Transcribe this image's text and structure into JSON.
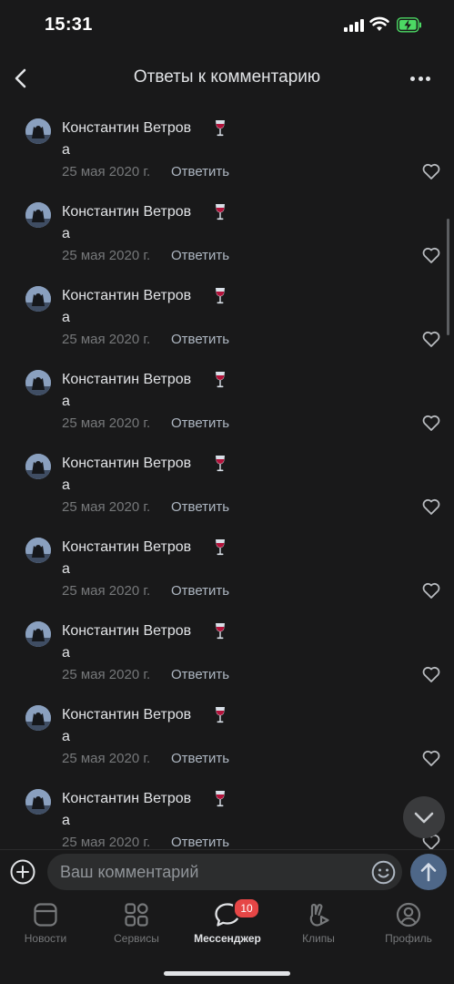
{
  "status_bar": {
    "time": "15:31"
  },
  "header": {
    "title": "Ответы к комментарию"
  },
  "comments": [
    {
      "author": "Константин Ветров",
      "text": "а",
      "date": "25 мая 2020 г.",
      "reply_label": "Ответить"
    },
    {
      "author": "Константин Ветров",
      "text": "а",
      "date": "25 мая 2020 г.",
      "reply_label": "Ответить"
    },
    {
      "author": "Константин Ветров",
      "text": "а",
      "date": "25 мая 2020 г.",
      "reply_label": "Ответить"
    },
    {
      "author": "Константин Ветров",
      "text": "а",
      "date": "25 мая 2020 г.",
      "reply_label": "Ответить"
    },
    {
      "author": "Константин Ветров",
      "text": "а",
      "date": "25 мая 2020 г.",
      "reply_label": "Ответить"
    },
    {
      "author": "Константин Ветров",
      "text": "а",
      "date": "25 мая 2020 г.",
      "reply_label": "Ответить"
    },
    {
      "author": "Константин Ветров",
      "text": "а",
      "date": "25 мая 2020 г.",
      "reply_label": "Ответить"
    },
    {
      "author": "Константин Ветров",
      "text": "а",
      "date": "25 мая 2020 г.",
      "reply_label": "Ответить"
    },
    {
      "author": "Константин Ветров",
      "text": "а",
      "date": "25 мая 2020 г.",
      "reply_label": "Ответить"
    }
  ],
  "composer": {
    "placeholder": "Ваш комментарий"
  },
  "tabbar": {
    "tabs": [
      {
        "label": "Новости",
        "icon": "news-icon"
      },
      {
        "label": "Сервисы",
        "icon": "services-icon"
      },
      {
        "label": "Мессенджер",
        "icon": "messenger-icon",
        "badge": "10",
        "active": true
      },
      {
        "label": "Клипы",
        "icon": "clips-icon"
      },
      {
        "label": "Профиль",
        "icon": "profile-icon"
      }
    ]
  },
  "colors": {
    "background": "#19191a",
    "text_primary": "#e1e3e6",
    "text_secondary": "#76787a",
    "badge": "#e64646",
    "send_button": "#4e6788"
  },
  "icons": {
    "author_badge": "wine-glass-icon",
    "like": "heart-icon",
    "add": "plus-circle-icon",
    "emoji": "smile-icon",
    "send": "arrow-up-icon",
    "scroll": "chevron-down-icon"
  }
}
